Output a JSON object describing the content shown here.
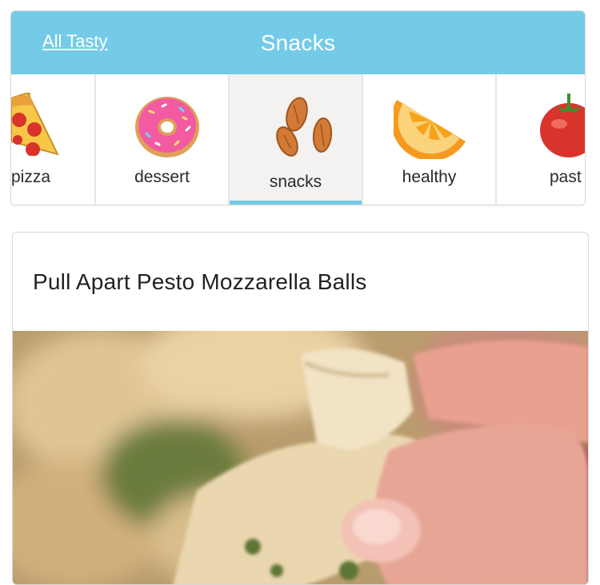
{
  "header": {
    "back_link": "All Tasty",
    "title": "Snacks"
  },
  "categories": [
    {
      "label": "pizza",
      "icon": "pizza-slice-icon",
      "selected": false
    },
    {
      "label": "dessert",
      "icon": "donut-icon",
      "selected": false
    },
    {
      "label": "snacks",
      "icon": "almonds-icon",
      "selected": true
    },
    {
      "label": "healthy",
      "icon": "orange-slice-icon",
      "selected": false
    },
    {
      "label": "past",
      "icon": "tomato-icon",
      "selected": false
    }
  ],
  "recipe": {
    "title": "Pull Apart Pesto Mozzarella Balls",
    "photo": "pull-apart-bread-photo"
  },
  "colors": {
    "header_bg": "#74cbe7",
    "active_tab_bg": "#f4f1f1",
    "active_indicator": "#74cbe7"
  }
}
